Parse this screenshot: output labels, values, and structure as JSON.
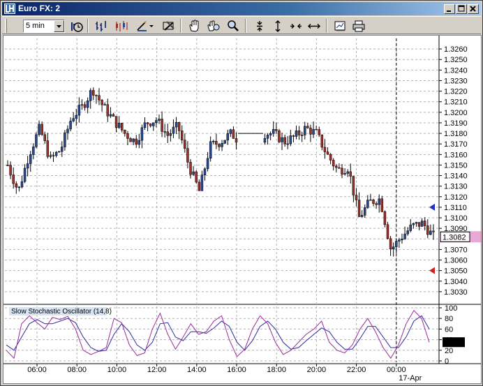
{
  "window": {
    "title": "Euro FX: 2"
  },
  "toolbar": {
    "interval": "5 min",
    "icons": [
      "bar-type-icon",
      "bar-chart-icon",
      "candlestick-icon",
      "draw-tool-icon",
      "properties-icon",
      "hand-icon",
      "zoom-hand-icon",
      "magnifier-icon",
      "compress-vertical-icon",
      "expand-vertical-icon",
      "compress-horizontal-icon",
      "expand-horizontal-icon",
      "data-box-icon",
      "print-icon"
    ]
  },
  "colors": {
    "bull_candle": "#2a4a90",
    "bear_candle": "#a0302a",
    "stoch_k": "#9a2a9a",
    "stoch_d": "#2a2aa0",
    "last_price_bg": "#e8a8d8",
    "grid": "#b0b0b0"
  },
  "chart_data": {
    "type": "candlestick",
    "ylim": [
      1.302,
      1.327
    ],
    "y_ticks": [
      "1.3260",
      "1.3250",
      "1.3240",
      "1.3230",
      "1.3220",
      "1.3210",
      "1.3200",
      "1.3190",
      "1.3180",
      "1.3170",
      "1.3160",
      "1.3150",
      "1.3140",
      "1.3130",
      "1.3120",
      "1.3110",
      "1.3100",
      "1.3090",
      "1.3080",
      "1.3070",
      "1.3060",
      "1.3050",
      "1.3040",
      "1.3030"
    ],
    "x_ticks": [
      "06:00",
      "08:00",
      "10:00",
      "12:00",
      "14:00",
      "16:00",
      "18:00",
      "20:00",
      "22:00",
      "00:00"
    ],
    "date_label": "17-Apr",
    "last_price": "1.3082",
    "close_path": [
      [
        0,
        1.315
      ],
      [
        1,
        1.3125
      ],
      [
        2,
        1.316
      ],
      [
        3,
        1.3185
      ],
      [
        4,
        1.3155
      ],
      [
        5,
        1.3165
      ],
      [
        6,
        1.3195
      ],
      [
        7,
        1.3205
      ],
      [
        8,
        1.3222
      ],
      [
        9,
        1.3205
      ],
      [
        10,
        1.3192
      ],
      [
        11,
        1.318
      ],
      [
        12,
        1.3172
      ],
      [
        13,
        1.319
      ],
      [
        14,
        1.3193
      ],
      [
        15,
        1.3178
      ],
      [
        16,
        1.3187
      ],
      [
        17,
        1.315
      ],
      [
        18,
        1.3125
      ],
      [
        19,
        1.3168
      ],
      [
        20,
        1.3172
      ],
      [
        21,
        1.318
      ],
      [
        22,
        1.317
      ],
      [
        23,
        1.318
      ],
      [
        24,
        1.318
      ],
      [
        25,
        1.318
      ],
      [
        26,
        1.3172
      ],
      [
        27,
        1.3177
      ],
      [
        28,
        1.3185
      ],
      [
        29,
        1.318
      ],
      [
        30,
        1.316
      ],
      [
        31,
        1.3145
      ],
      [
        32,
        1.3148
      ],
      [
        33,
        1.31
      ],
      [
        34,
        1.3115
      ],
      [
        35,
        1.3118
      ],
      [
        36,
        1.307
      ],
      [
        37,
        1.3082
      ],
      [
        38,
        1.3092
      ],
      [
        39,
        1.3095
      ],
      [
        40,
        1.3082
      ]
    ],
    "markers": {
      "upper_value": 1.311,
      "lower_value": 1.305
    },
    "oscillator": {
      "title": "Slow Stochastic Oscillator (14,8)",
      "ylim": [
        0,
        100
      ],
      "y_ticks": [
        "100",
        "80",
        "60",
        "40",
        "20",
        "0"
      ],
      "last_value": "35.24",
      "k_values": [
        20,
        5,
        70,
        85,
        72,
        60,
        82,
        78,
        84,
        60,
        20,
        12,
        18,
        25,
        80,
        72,
        30,
        10,
        15,
        60,
        90,
        50,
        22,
        45,
        70,
        50,
        55,
        75,
        85,
        40,
        8,
        22,
        60,
        85,
        70,
        35,
        12,
        20,
        35,
        50,
        60,
        75,
        35,
        20,
        15,
        30,
        60,
        80,
        55,
        25,
        5,
        30,
        70,
        95,
        80,
        35
      ],
      "d_values": [
        30,
        20,
        45,
        70,
        78,
        70,
        70,
        75,
        80,
        72,
        45,
        25,
        18,
        20,
        50,
        70,
        55,
        30,
        20,
        35,
        70,
        72,
        45,
        38,
        55,
        55,
        52,
        62,
        75,
        65,
        35,
        20,
        38,
        65,
        75,
        60,
        35,
        22,
        25,
        38,
        50,
        62,
        55,
        35,
        22,
        22,
        42,
        65,
        65,
        45,
        25,
        25,
        45,
        75,
        85,
        60
      ]
    }
  }
}
